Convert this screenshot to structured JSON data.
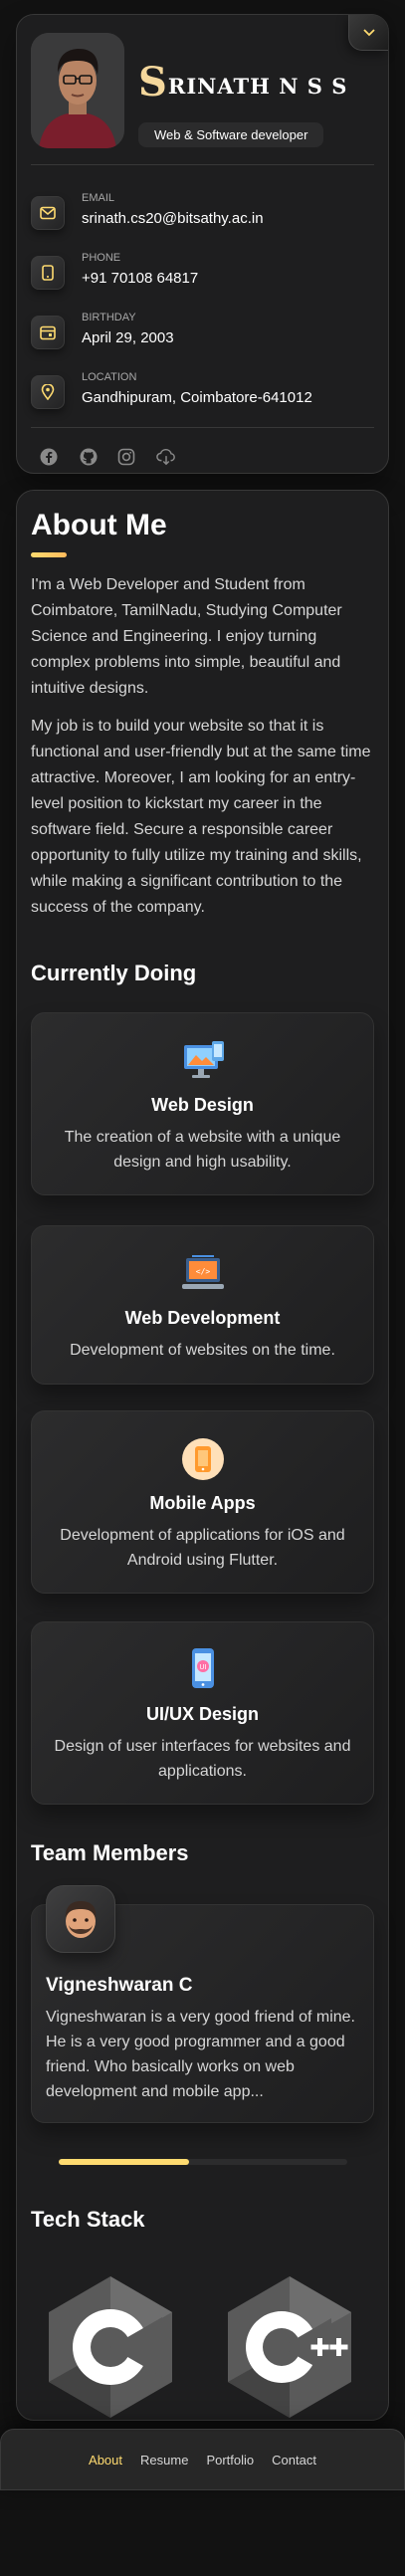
{
  "profile": {
    "name_initial": "S",
    "name_rest": "RINATH N S S",
    "title": "Web & Software developer",
    "avatar_desc": "profile photo",
    "contacts": [
      {
        "icon": "mail-icon",
        "title": "Email",
        "value": "srinath.cs20@bitsathy.ac.in"
      },
      {
        "icon": "phone-icon",
        "title": "Phone",
        "value": "+91 70108 64817"
      },
      {
        "icon": "calendar-icon",
        "title": "Birthday",
        "value": "April 29, 2003"
      },
      {
        "icon": "location-icon",
        "title": "Location",
        "value": "Gandhipuram, Coimbatore-641012"
      }
    ],
    "socials": [
      "facebook-icon",
      "github-icon",
      "instagram-icon",
      "cloud-download-icon"
    ]
  },
  "about": {
    "title": "About Me",
    "paragraph_1": "I'm a Web Developer and Student from Coimbatore, TamilNadu, Studying Computer Science and Engineering. I enjoy turning complex problems into simple, beautiful and intuitive designs.",
    "paragraph_2": "My job is to build your website so that it is functional and user-friendly but at the same time attractive. Moreover, I am looking for an entry-level position to kickstart my career in the software field. Secure a responsible career opportunity to fully utilize my training and skills, while making a significant contribution to the success of the company."
  },
  "services": {
    "title": "Currently Doing",
    "items": [
      {
        "icon": "design-icon",
        "title": "Web Design",
        "text": "The creation of a website with a unique design and high usability."
      },
      {
        "icon": "dev-icon",
        "title": "Web Development",
        "text": "Development of websites on the time."
      },
      {
        "icon": "app-icon",
        "title": "Mobile Apps",
        "text": "Development of applications for iOS and Android using Flutter."
      },
      {
        "icon": "ui-icon",
        "title": "UI/UX Design",
        "text": "Design of user interfaces for websites and applications."
      }
    ]
  },
  "team": {
    "title": "Team Members",
    "members": [
      {
        "name": "Vigneshwaran C",
        "text": "Vigneshwaran is a very good friend of mine. He is a very good programmer and a good friend. Who basically works on web development and mobile app..."
      }
    ],
    "scroll_progress": 0.45
  },
  "tech": {
    "title": "Tech Stack",
    "items": [
      {
        "label": "C"
      },
      {
        "label": "C++"
      }
    ]
  },
  "navbar": {
    "links": [
      "About",
      "Resume",
      "Portfolio",
      "Contact"
    ],
    "active": "About"
  },
  "colors": {
    "accent": "#ffdb70",
    "background": "#121212",
    "card": "#1e1e1f"
  }
}
